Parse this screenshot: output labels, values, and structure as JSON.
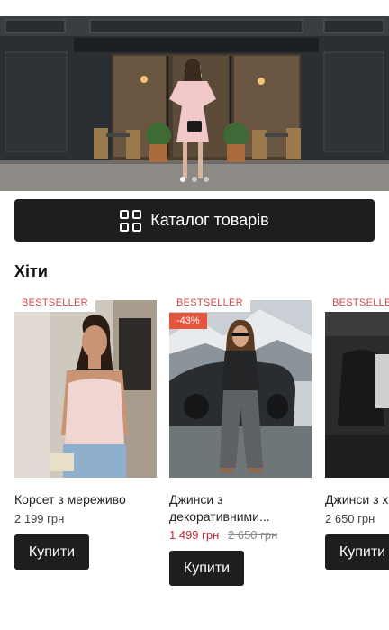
{
  "hero": {
    "slides_count": 3,
    "active_slide": 1
  },
  "catalog": {
    "label": "Каталог товарів",
    "icon": "grid-icon"
  },
  "section": {
    "title": "Хіти"
  },
  "products": [
    {
      "badge": "BESTSELLER",
      "discount": "",
      "name": "Корсет з мереживо",
      "price": "2 199 грн",
      "old_price": "",
      "buy_label": "Купити"
    },
    {
      "badge": "BESTSELLER",
      "discount": "-43%",
      "name": "Джинси з декоративними...",
      "price": "1 499 грн",
      "old_price": "2 650 грн",
      "buy_label": "Купити"
    },
    {
      "badge": "BESTSELLER",
      "discount": "",
      "name": "Джинси з х",
      "price": "2 650 грн",
      "old_price": "",
      "buy_label": "Купити"
    }
  ],
  "colors": {
    "button_bg": "#1e1e1e",
    "badge_text": "#d0464c",
    "discount_bg": "#e5543c",
    "sale_price": "#c8283b"
  }
}
